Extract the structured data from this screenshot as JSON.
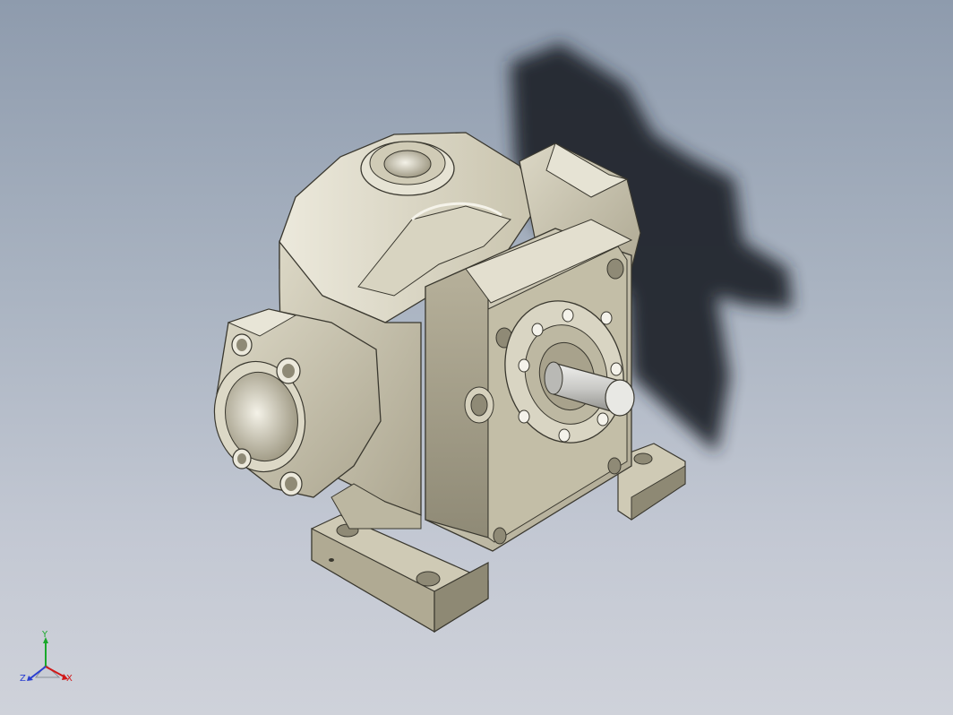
{
  "viewport": {
    "background_top": "#8e9bad",
    "background_bottom": "#cfd2da"
  },
  "model": {
    "body_color": "#cbc6b0",
    "shadow_color": "#24282f",
    "shaft_color": "#c9c9c6"
  },
  "triad": {
    "x_label": "X",
    "y_label": "Y",
    "z_label": "Z",
    "x_color": "#d01818",
    "y_color": "#19a82a",
    "z_color": "#2a3ed0"
  }
}
